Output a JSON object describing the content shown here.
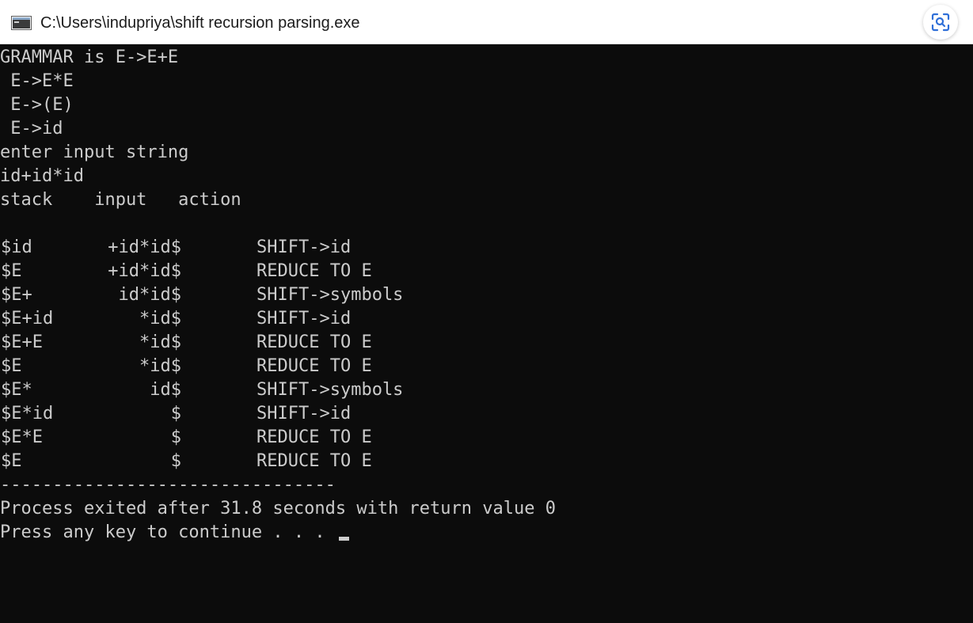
{
  "window": {
    "title": "C:\\Users\\indupriya\\shift recursion parsing.exe",
    "app_icon": "console-app-icon",
    "lens_icon": "visual-search-icon"
  },
  "console": {
    "grammar_lines": [
      "GRAMMAR is E->E+E",
      " E->E*E",
      " E->(E)",
      " E->id"
    ],
    "prompt": "enter input string",
    "input_value": "id+id*id",
    "table_header": "stack    input   action",
    "rows": [
      {
        "stack": "$id",
        "input": "+id*id$",
        "action": "SHIFT->id"
      },
      {
        "stack": "$E",
        "input": "+id*id$",
        "action": "REDUCE TO E"
      },
      {
        "stack": "$E+",
        "input": "id*id$",
        "action": "SHIFT->symbols"
      },
      {
        "stack": "$E+id",
        "input": "*id$",
        "action": "SHIFT->id"
      },
      {
        "stack": "$E+E",
        "input": "*id$",
        "action": "REDUCE TO E"
      },
      {
        "stack": "$E",
        "input": "*id$",
        "action": "REDUCE TO E"
      },
      {
        "stack": "$E*",
        "input": "id$",
        "action": "SHIFT->symbols"
      },
      {
        "stack": "$E*id",
        "input": "$",
        "action": "SHIFT->id"
      },
      {
        "stack": "$E*E",
        "input": "$",
        "action": "REDUCE TO E"
      },
      {
        "stack": "$E",
        "input": "$",
        "action": "REDUCE TO E"
      }
    ],
    "separator": "--------------------------------",
    "exit_message": "Process exited after 31.8 seconds with return value 0",
    "continue_prompt": "Press any key to continue . . . "
  },
  "colors": {
    "console_bg": "#0c0c0c",
    "console_fg": "#cccccc",
    "titlebar_bg": "#ffffff",
    "lens_accent": "#2f6fd8"
  }
}
